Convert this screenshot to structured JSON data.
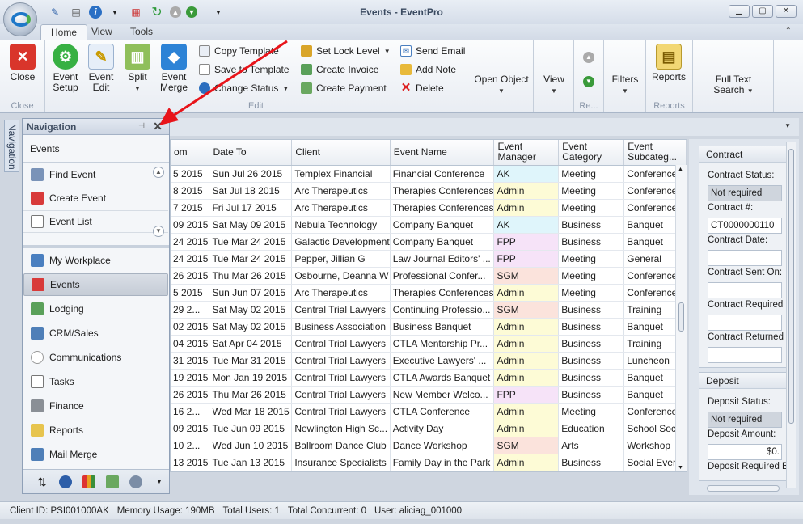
{
  "window": {
    "title": "Events - EventPro"
  },
  "tabs": [
    "Home",
    "View",
    "Tools"
  ],
  "ribbon": {
    "close_label": "Close",
    "close_group": "Close",
    "event_setup": "Event Setup",
    "event_edit": "Event Edit",
    "split": "Split",
    "event_merge": "Event Merge",
    "copy_template": "Copy Template",
    "save_template": "Save to Template",
    "change_status": "Change Status",
    "set_lock": "Set Lock Level",
    "create_invoice": "Create Invoice",
    "create_payment": "Create Payment",
    "send_email": "Send Email",
    "add_note": "Add Note",
    "delete": "Delete",
    "edit_group": "Edit",
    "open_object": "Open Object",
    "view": "View",
    "re_group": "Re...",
    "filters": "Filters",
    "reports": "Reports",
    "reports_group": "Reports",
    "full_text": "Full Text Search"
  },
  "nav": {
    "strip_label": "Navigation",
    "title": "Navigation",
    "subheader": "Events",
    "sub_items": [
      "Find Event",
      "Create Event",
      "Event List"
    ],
    "items": [
      "My Workplace",
      "Events",
      "Lodging",
      "CRM/Sales",
      "Communications",
      "Tasks",
      "Finance",
      "Reports",
      "Mail Merge"
    ]
  },
  "grid": {
    "columns": [
      "om",
      "Date To",
      "Client",
      "Event Name",
      "Event Manager",
      "Event Category",
      "Event Subcateg..."
    ],
    "rows": [
      [
        "5 2015",
        "Sun Jul 26 2015",
        "Templex Financial",
        "Financial Conference",
        "AK",
        "Meeting",
        "Conference"
      ],
      [
        "8 2015",
        "Sat Jul 18 2015",
        "Arc Therapeutics",
        "Therapies Conferences",
        "Admin",
        "Meeting",
        "Conference"
      ],
      [
        "7 2015",
        "Fri Jul 17 2015",
        "Arc Therapeutics",
        "Therapies Conferences",
        "Admin",
        "Meeting",
        "Conference"
      ],
      [
        "09 2015",
        "Sat May 09 2015",
        "Nebula Technology",
        "Company Banquet",
        "AK",
        "Business",
        "Banquet"
      ],
      [
        "24 2015",
        "Tue Mar 24 2015",
        "Galactic Development",
        "Company Banquet",
        "FPP",
        "Business",
        "Banquet"
      ],
      [
        "24 2015",
        "Tue Mar 24 2015",
        "Pepper, Jillian G",
        "Law Journal Editors' ...",
        "FPP",
        "Meeting",
        "General"
      ],
      [
        "26 2015",
        "Thu Mar 26 2015",
        "Osbourne, Deanna W",
        "Professional Confer...",
        "SGM",
        "Meeting",
        "Conference"
      ],
      [
        "5 2015",
        "Sun Jun 07 2015",
        "Arc Therapeutics",
        "Therapies Conferences",
        "Admin",
        "Meeting",
        "Conference"
      ],
      [
        "29 2...",
        "Sat May 02 2015",
        "Central Trial Lawyers",
        "Continuing Professio...",
        "SGM",
        "Business",
        "Training"
      ],
      [
        "02 2015",
        "Sat May 02 2015",
        "Business Association",
        "Business Banquet",
        "Admin",
        "Business",
        "Banquet"
      ],
      [
        "04 2015",
        "Sat Apr 04 2015",
        "Central Trial Lawyers",
        "CTLA Mentorship Pr...",
        "Admin",
        "Business",
        "Training"
      ],
      [
        "31 2015",
        "Tue Mar 31 2015",
        "Central Trial Lawyers",
        "Executive Lawyers' ...",
        "Admin",
        "Business",
        "Luncheon"
      ],
      [
        "19 2015",
        "Mon Jan 19 2015",
        "Central Trial Lawyers",
        "CTLA Awards Banquet",
        "Admin",
        "Business",
        "Banquet"
      ],
      [
        "26 2015",
        "Thu Mar 26 2015",
        "Central Trial Lawyers",
        "New Member Welco...",
        "FPP",
        "Business",
        "Banquet"
      ],
      [
        "16 2...",
        "Wed Mar 18 2015",
        "Central Trial Lawyers",
        "CTLA Conference",
        "Admin",
        "Meeting",
        "Conference"
      ],
      [
        "09 2015",
        "Tue Jun 09 2015",
        "Newlington High Sc...",
        "Activity Day",
        "Admin",
        "Education",
        "School Social"
      ],
      [
        "10 2...",
        "Wed Jun 10 2015",
        "Ballroom Dance Club",
        "Dance Workshop",
        "SGM",
        "Arts",
        "Workshop"
      ],
      [
        "13 2015",
        "Tue Jan 13 2015",
        "Insurance Specialists",
        "Family Day in the Park",
        "Admin",
        "Business",
        "Social Event"
      ]
    ],
    "manager_colors": {
      "AK": "#dff5fb",
      "Admin": "#fdfbd6",
      "FPP": "#f6e3f8",
      "SGM": "#fbe3dc"
    }
  },
  "contract": {
    "header": "Contract",
    "status_label": "Contract Status:",
    "status_value": "Not required",
    "number_label": "Contract #:",
    "number_value": "CT0000000110",
    "date_label": "Contract Date:",
    "sent_label": "Contract Sent On:",
    "required_label": "Contract Required I",
    "returned_label": "Contract Returned"
  },
  "deposit": {
    "header": "Deposit",
    "status_label": "Deposit Status:",
    "status_value": "Not required",
    "amount_label": "Deposit Amount:",
    "amount_value": "$0.",
    "required_label": "Deposit Required By"
  },
  "status": {
    "client_id": "Client ID: PSI001000AK",
    "memory": "Memory Usage: 190MB",
    "users": "Total Users: 1",
    "concurrent": "Total Concurrent: 0",
    "user": "User: aliciag_001000"
  }
}
